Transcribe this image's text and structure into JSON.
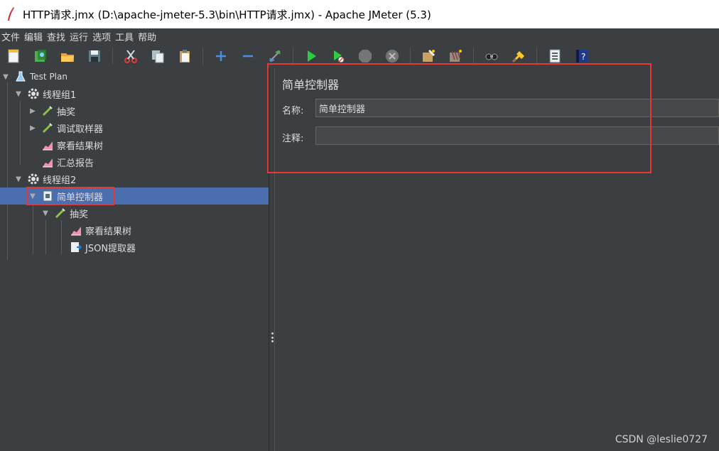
{
  "window": {
    "title": "HTTP请求.jmx (D:\\apache-jmeter-5.3\\bin\\HTTP请求.jmx) - Apache JMeter (5.3)"
  },
  "menu": [
    "文件",
    "编辑",
    "查找",
    "运行",
    "选项",
    "工具",
    "帮助"
  ],
  "toolbar": {
    "icons": [
      "new-icon",
      "templates-icon",
      "open-icon",
      "save-icon",
      "cut-icon",
      "copy-icon",
      "paste-icon",
      "expand-icon",
      "collapse-icon",
      "toggle-icon",
      "start-icon",
      "start-no-pause-icon",
      "stop-icon",
      "shutdown-icon",
      "clear-icon",
      "clear-all-icon",
      "search-icon",
      "reset-search-icon",
      "function-helper-icon",
      "help-icon"
    ]
  },
  "tree": {
    "items": [
      {
        "label": "Test Plan"
      },
      {
        "label": "线程组1"
      },
      {
        "label": "抽奖"
      },
      {
        "label": "调试取样器"
      },
      {
        "label": "察看结果树"
      },
      {
        "label": "汇总报告"
      },
      {
        "label": "线程组2"
      },
      {
        "label": "简单控制器"
      },
      {
        "label": "抽奖"
      },
      {
        "label": "察看结果树"
      },
      {
        "label": "JSON提取器"
      }
    ]
  },
  "panel": {
    "title": "简单控制器",
    "name_label": "名称:",
    "name_value": "简单控制器",
    "comment_label": "注释:",
    "comment_value": ""
  },
  "watermark": "CSDN @leslie0727",
  "colors": {
    "background": "#3c3f41",
    "selected": "#4b6eaf",
    "highlight": "#e53935"
  }
}
